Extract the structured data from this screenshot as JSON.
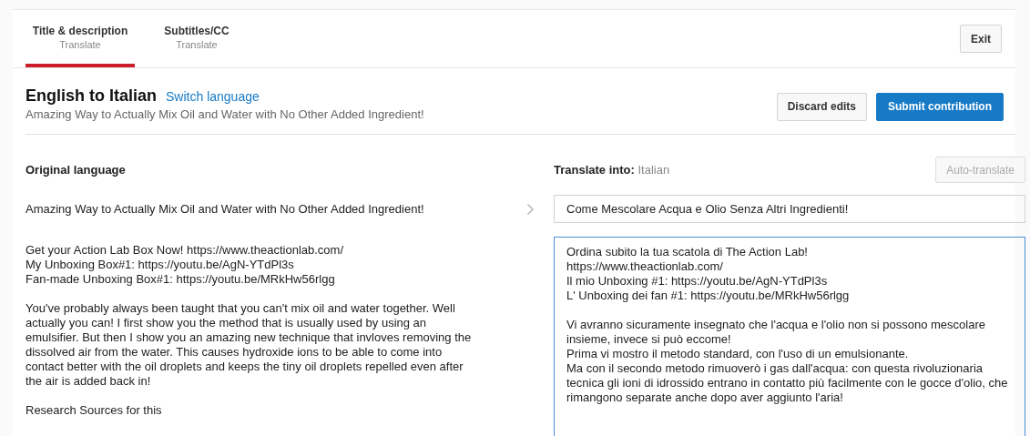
{
  "tabs": [
    {
      "label": "Title & description",
      "sublabel": "Translate",
      "selected": true
    },
    {
      "label": "Subtitles/CC",
      "sublabel": "Translate",
      "selected": false
    }
  ],
  "exit_button": "Exit",
  "header": {
    "title": "English to Italian",
    "switch_link": "Switch language",
    "subtitle": "Amazing Way to Actually Mix Oil and Water with No Other Added Ingredient!",
    "discard_button": "Discard edits",
    "submit_button": "Submit contribution"
  },
  "original": {
    "heading": "Original language",
    "title": "Amazing Way to Actually Mix Oil and Water with No Other Added Ingredient!",
    "description": "Get your Action Lab Box Now! https://www.theactionlab.com/\nMy Unboxing Box#1: https://youtu.be/AgN-YTdPl3s\nFan-made Unboxing Box#1: https://youtu.be/MRkHw56rlgg\n\nYou've probably always been taught that you can't mix oil and water together. Well actually you can! I first show you the method that is usually used by using an emulsifier. But then I show you an amazing new technique that invloves removing the dissolved air from the water. This causes hydroxide ions to be able to come into contact better with the oil droplets and keeps the tiny oil droplets repelled even after the air is added back in!\n\nResearch Sources for this"
  },
  "translation": {
    "heading_label": "Translate into:",
    "language": "Italian",
    "auto_translate_button": "Auto-translate",
    "auto_translate_disabled": true,
    "title": "Come Mescolare Acqua e Olio Senza Altri Ingredienti!",
    "description": "Ordina subito la tua scatola di The Action Lab!\nhttps://www.theactionlab.com/\nIl mio Unboxing #1: https://youtu.be/AgN-YTdPl3s\nL' Unboxing dei fan #1: https://youtu.be/MRkHw56rlgg\n\nVi avranno sicuramente insegnato che l'acqua e l'olio non si possono mescolare insieme, invece si può eccome!\nPrima vi mostro il metodo standard, con l'uso di un emulsionante.\nMa con il secondo metodo rimuoverò i gas dall'acqua: con questa rivoluzionaria tecnica gli ioni di idrossido entrano in contatto più facilmente con le gocce d'olio, che rimangono separate anche dopo aver aggiunto l'aria!",
    "description_focused": true
  }
}
